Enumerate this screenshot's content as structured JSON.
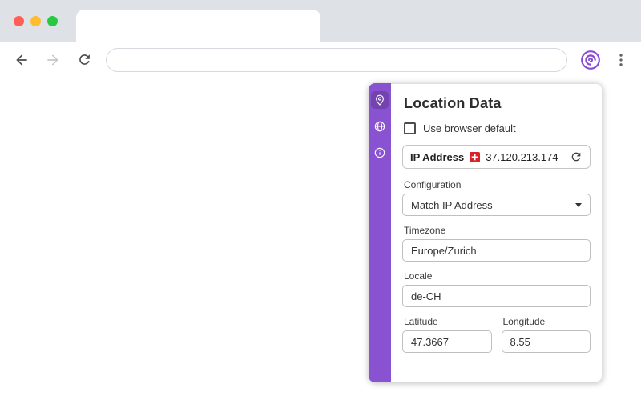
{
  "colors": {
    "accent_purple": "#8952d0",
    "flag_red": "#d8232a",
    "titlebar_gray": "#dee1e6"
  },
  "icons": {
    "toolbar": [
      "back-arrow",
      "forward-arrow",
      "reload",
      "vytal-extension-logo",
      "more-vert-menu"
    ],
    "rail": [
      "location-pin",
      "globe",
      "info-circle"
    ],
    "traffic_lights": [
      "close",
      "minimize",
      "zoom"
    ]
  },
  "browser": {
    "tab_title": "",
    "address_value": ""
  },
  "panel": {
    "title": "Location Data",
    "use_default_label": "Use browser default",
    "use_default_checked": false,
    "ip_label": "IP Address",
    "ip_value": "37.120.213.174",
    "ip_flag_country": "Switzerland",
    "configuration_label": "Configuration",
    "configuration_value": "Match IP Address",
    "timezone_label": "Timezone",
    "timezone_value": "Europe/Zurich",
    "locale_label": "Locale",
    "locale_value": "de-CH",
    "latitude_label": "Latitude",
    "latitude_value": "47.3667",
    "longitude_label": "Longitude",
    "longitude_value": "8.55"
  }
}
